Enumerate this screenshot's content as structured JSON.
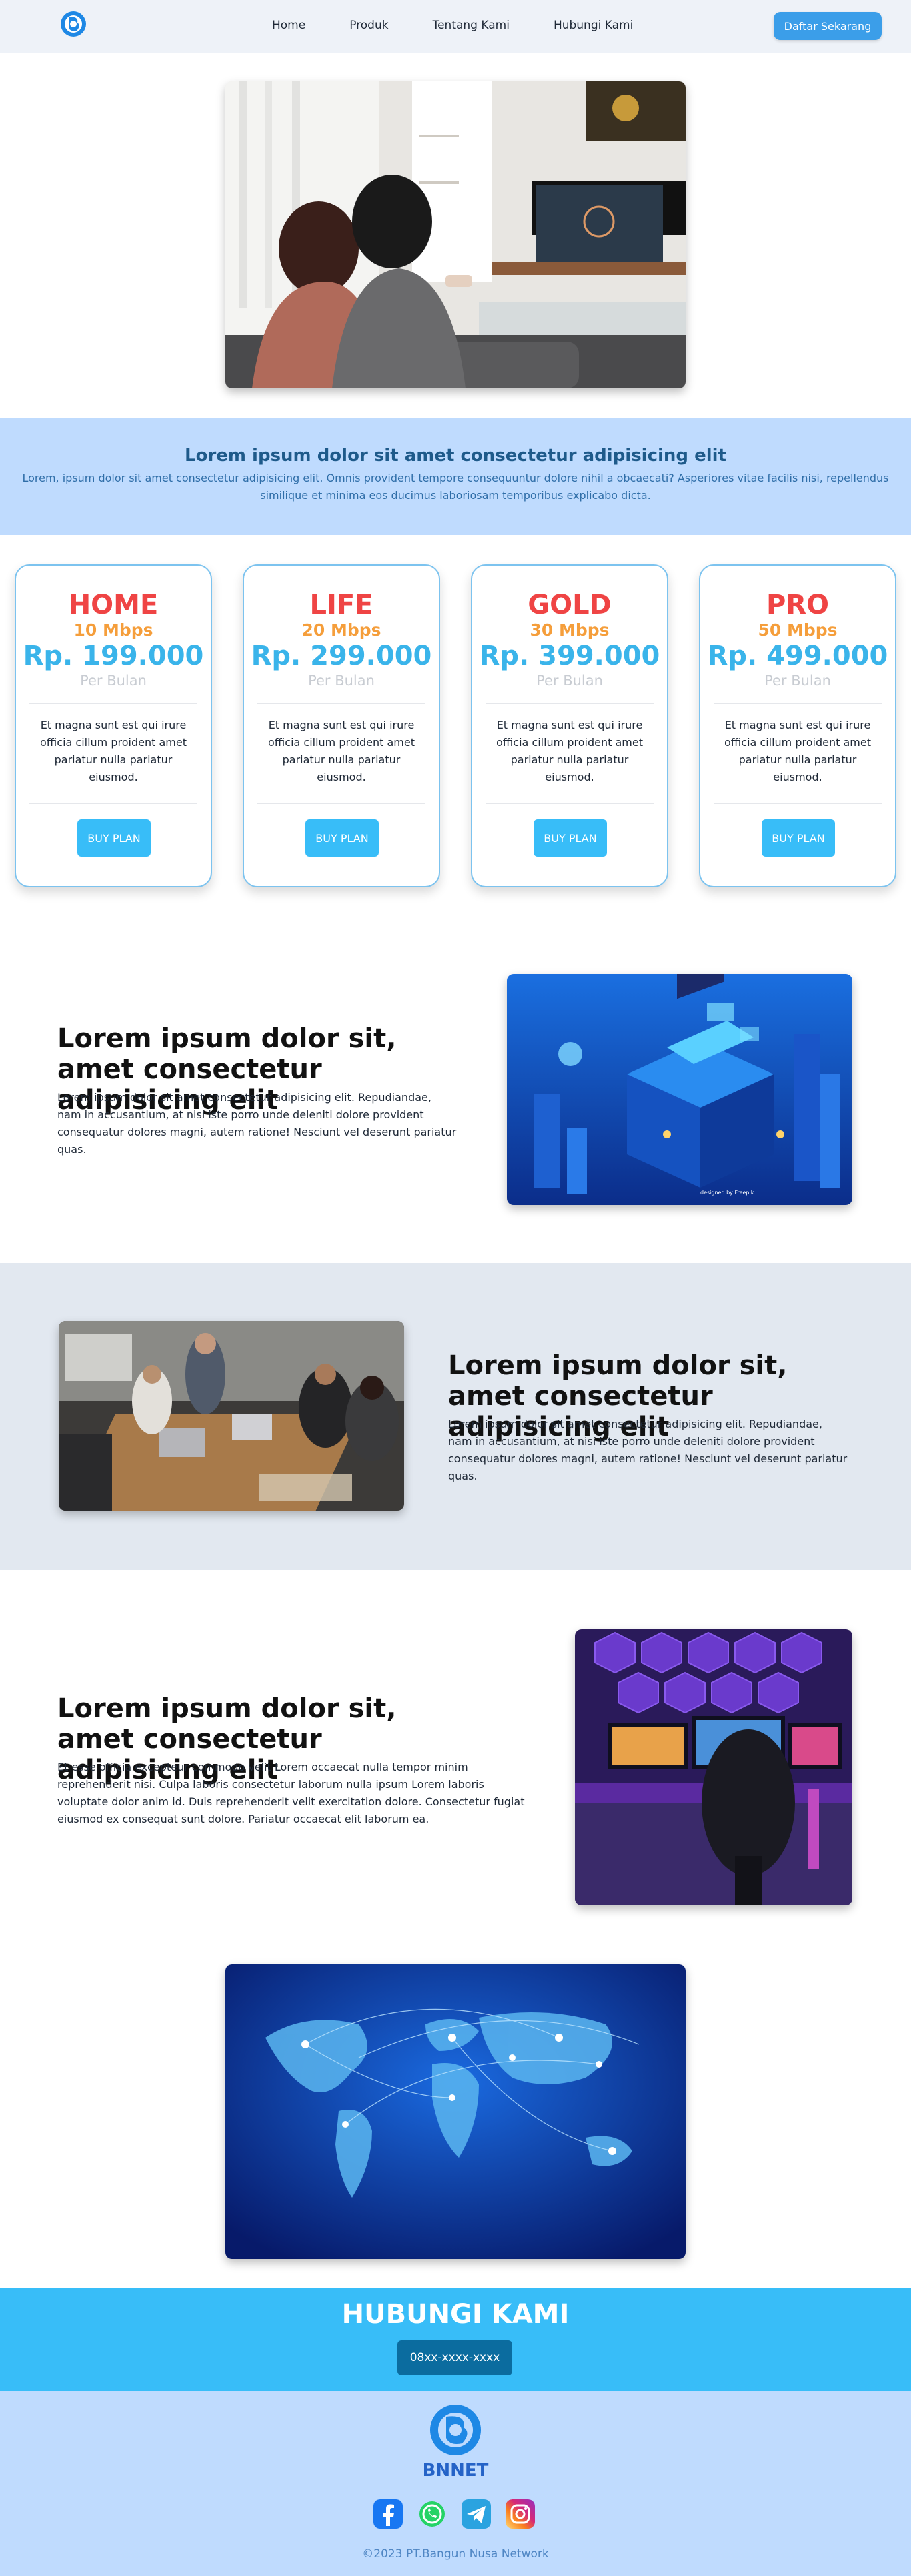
{
  "nav": {
    "links": [
      "Home",
      "Produk",
      "Tentang Kami",
      "Hubungi Kami"
    ],
    "cta_label": "Daftar Sekarang"
  },
  "banner": {
    "title": "Lorem ipsum dolor sit amet consectetur adipisicing elit",
    "text": "Lorem, ipsum dolor sit amet consectetur adipisicing elit. Omnis provident tempore consequuntur dolore nihil a obcaecati? Asperiores vitae facilis nisi, repellendus similique et minima eos ducimus laboriosam temporibus explicabo dicta."
  },
  "plans": [
    {
      "name": "HOME",
      "speed": "10 Mbps",
      "price": "Rp. 199.000",
      "period": "Per Bulan",
      "desc": "Et magna sunt est qui irure officia cillum proident amet pariatur nulla pariatur eiusmod.",
      "button": "BUY PLAN"
    },
    {
      "name": "LIFE",
      "speed": "20 Mbps",
      "price": "Rp. 299.000",
      "period": "Per Bulan",
      "desc": "Et magna sunt est qui irure officia cillum proident amet pariatur nulla pariatur eiusmod.",
      "button": "BUY PLAN"
    },
    {
      "name": "GOLD",
      "speed": "30 Mbps",
      "price": "Rp. 399.000",
      "period": "Per Bulan",
      "desc": "Et magna sunt est qui irure officia cillum proident amet pariatur nulla pariatur eiusmod.",
      "button": "BUY PLAN"
    },
    {
      "name": "PRO",
      "speed": "50 Mbps",
      "price": "Rp. 499.000",
      "period": "Per Bulan",
      "desc": "Et magna sunt est qui irure officia cillum proident amet pariatur nulla pariatur eiusmod.",
      "button": "BUY PLAN"
    }
  ],
  "features": [
    {
      "title": "Lorem ipsum dolor sit, amet consectetur adipisicing elit",
      "text": "Lorem ipsum dolor sit amet consectetur adipisicing elit. Repudiandae, nam in accusantium, at nisi iste porro unde deleniti dolore provident consequatur dolores magni, autem ratione! Nesciunt vel deserunt pariatur quas.",
      "image_caption": "designed by Freepik"
    },
    {
      "title": "Lorem ipsum dolor sit, amet consectetur adipisicing elit",
      "text": "Lorem ipsum dolor sit amet consectetur adipisicing elit. Repudiandae, nam in accusantium, at nisi iste porro unde deleniti dolore provident consequatur dolores magni, autem ratione! Nesciunt vel deserunt pariatur quas."
    },
    {
      "title": "Lorem ipsum dolor sit, amet consectetur adipisicing elit",
      "text": "Et esse officia excepteur commodo velit Lorem occaecat nulla tempor minim reprehenderit nisi. Culpa laboris consectetur laborum nulla ipsum Lorem laboris voluptate dolor anim id. Duis reprehenderit velit exercitation dolore. Consectetur fugiat eiusmod ex consequat sunt dolore. Pariatur occaecat elit laborum ea."
    }
  ],
  "contact": {
    "title": "HUBUNGI KAMI",
    "phone": "08xx-xxxx-xxxx"
  },
  "footer": {
    "brand": "BNNET",
    "copyright": "©2023 PT.Bangun Nusa Network",
    "social_icons": [
      "facebook-icon",
      "whatsapp-icon",
      "telegram-icon",
      "instagram-icon"
    ]
  },
  "colors": {
    "accent": "#38bdf8",
    "plan_name": "#ef4444",
    "plan_speed": "#f59e3b",
    "banner_bg": "#bfdbfe",
    "section_gray": "#e2e8f0"
  }
}
